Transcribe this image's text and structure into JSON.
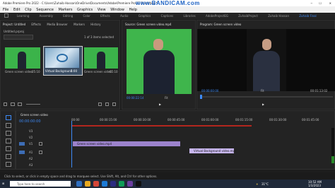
{
  "title_bar": {
    "app_title": "Adobe Premiere Pro 2022 - C:\\Users\\Zuhaib Hassan\\OneDrive\\Documents\\Adobe\\Premiere Pro\\22.0\\Untitled *",
    "watermark": "www.BANDICAM.com"
  },
  "menu": [
    "File",
    "Edit",
    "Clip",
    "Sequence",
    "Markers",
    "Graphics",
    "View",
    "Window",
    "Help"
  ],
  "workspaces": [
    "Learning",
    "Assembly",
    "Editing",
    "Color",
    "Effects",
    "Audio",
    "Graphics",
    "Captions",
    "Libraries",
    "AdobeProjectEG",
    "ZuhaibProject",
    "Zuhaib Hassan",
    "Zuhaib Final"
  ],
  "project_panel": {
    "tabs": [
      "Project: Untitled",
      "Effects",
      "Media Browser",
      "Markers",
      "History"
    ],
    "project_name": "Untitled.prproj",
    "selection_info": "1 of 3 items selected",
    "items": [
      {
        "name": "Green screen video",
        "duration": "05:10"
      },
      {
        "name": "Virtual Background",
        "duration": "5:00"
      },
      {
        "name": "Green screen video",
        "duration": "05:10"
      }
    ]
  },
  "source_panel": {
    "title": "Source: Green screen video.mp4",
    "timecode": "00:00:22:14",
    "fit": "Fit"
  },
  "program_panel": {
    "title": "Program: Green screen video",
    "timecode": "00:00:00:00",
    "fit": "Fit",
    "duration": "00:01:13:02"
  },
  "timeline": {
    "tab": "Green screen video",
    "timecode": "00:00:00:00",
    "ruler_labels": [
      "00:00",
      "00:00:15:00",
      "00:00:30:00",
      "00:00:45:00",
      "00:01:00:00",
      "00:01:15:00",
      "00:01:30:00",
      "00:01:45:00"
    ],
    "video_tracks": [
      "V3",
      "V2",
      "V1"
    ],
    "audio_tracks": [
      "A1",
      "A2",
      "A3"
    ],
    "clips": [
      {
        "label": "Green screen video.mp4"
      },
      {
        "label": "Virtual Background video.mp4"
      }
    ]
  },
  "status_bar": {
    "hint": "Click to select, or click in empty space and drag to marquee select. Use Shift, Alt, and Ctrl for other options."
  },
  "taskbar": {
    "search_placeholder": "Type here to search",
    "weather": "31°C",
    "time": "10:52 AM",
    "date": "1/3/2023"
  }
}
